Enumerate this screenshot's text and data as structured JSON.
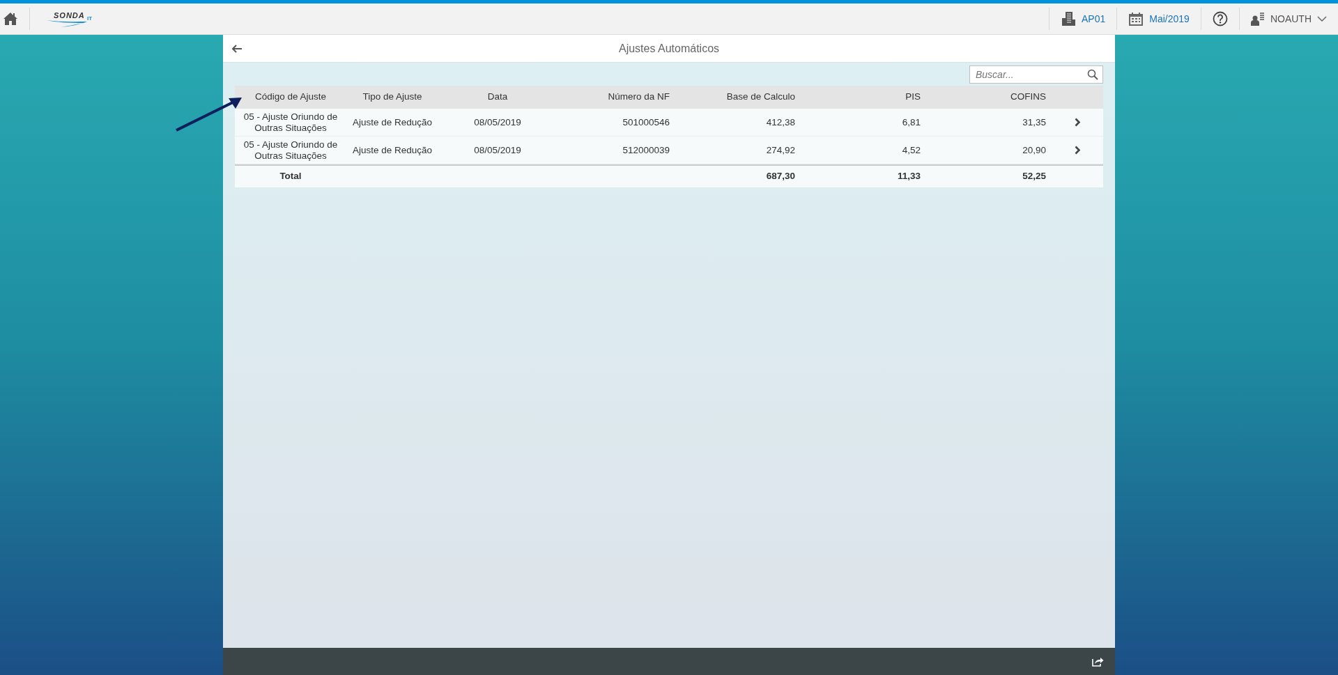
{
  "shell": {
    "logo": {
      "text": "SONDA",
      "suffix": "IT"
    },
    "company": "AP01",
    "period": "Mai/2019",
    "user": "NOAUTH"
  },
  "page": {
    "title": "Ajustes Automáticos"
  },
  "search": {
    "placeholder": "Buscar..."
  },
  "table": {
    "columns": [
      "Código de Ajuste",
      "Tipo de Ajuste",
      "Data",
      "Número da NF",
      "Base de Calculo",
      "PIS",
      "COFINS"
    ],
    "rows": [
      {
        "cells": [
          "05 - Ajuste Oriundo de Outras Situações",
          "Ajuste de Redução",
          "08/05/2019",
          "501000546",
          "412,38",
          "6,81",
          "31,35"
        ]
      },
      {
        "cells": [
          "05 - Ajuste Oriundo de Outras Situações",
          "Ajuste de Redução",
          "08/05/2019",
          "512000039",
          "274,92",
          "4,52",
          "20,90"
        ]
      }
    ],
    "total": {
      "label": "Total",
      "cells": [
        "687,30",
        "11,33",
        "52,25"
      ]
    }
  }
}
